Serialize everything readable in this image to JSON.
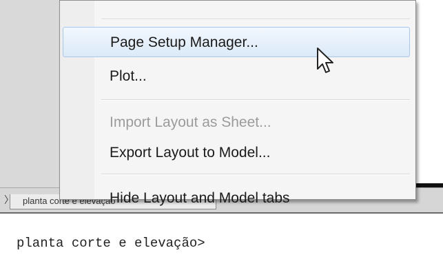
{
  "context_menu": {
    "items": [
      {
        "label": "Page Setup Manager...",
        "state": "highlighted"
      },
      {
        "label": "Plot...",
        "state": "enabled"
      },
      {
        "label": "Import Layout as Sheet...",
        "state": "disabled"
      },
      {
        "label": "Export Layout to Model...",
        "state": "enabled"
      },
      {
        "label": "Hide Layout and Model tabs",
        "state": "enabled"
      }
    ]
  },
  "tabs": {
    "layout_tab_label": "planta corte e elevação"
  },
  "command_line": {
    "text": "planta corte e elevação>"
  },
  "colors": {
    "highlight": "#dbe9f8",
    "highlight_border": "#a9c7ea",
    "disabled_text": "#9b9b9b"
  },
  "icons": {
    "cursor": "mouse-pointer-icon"
  }
}
